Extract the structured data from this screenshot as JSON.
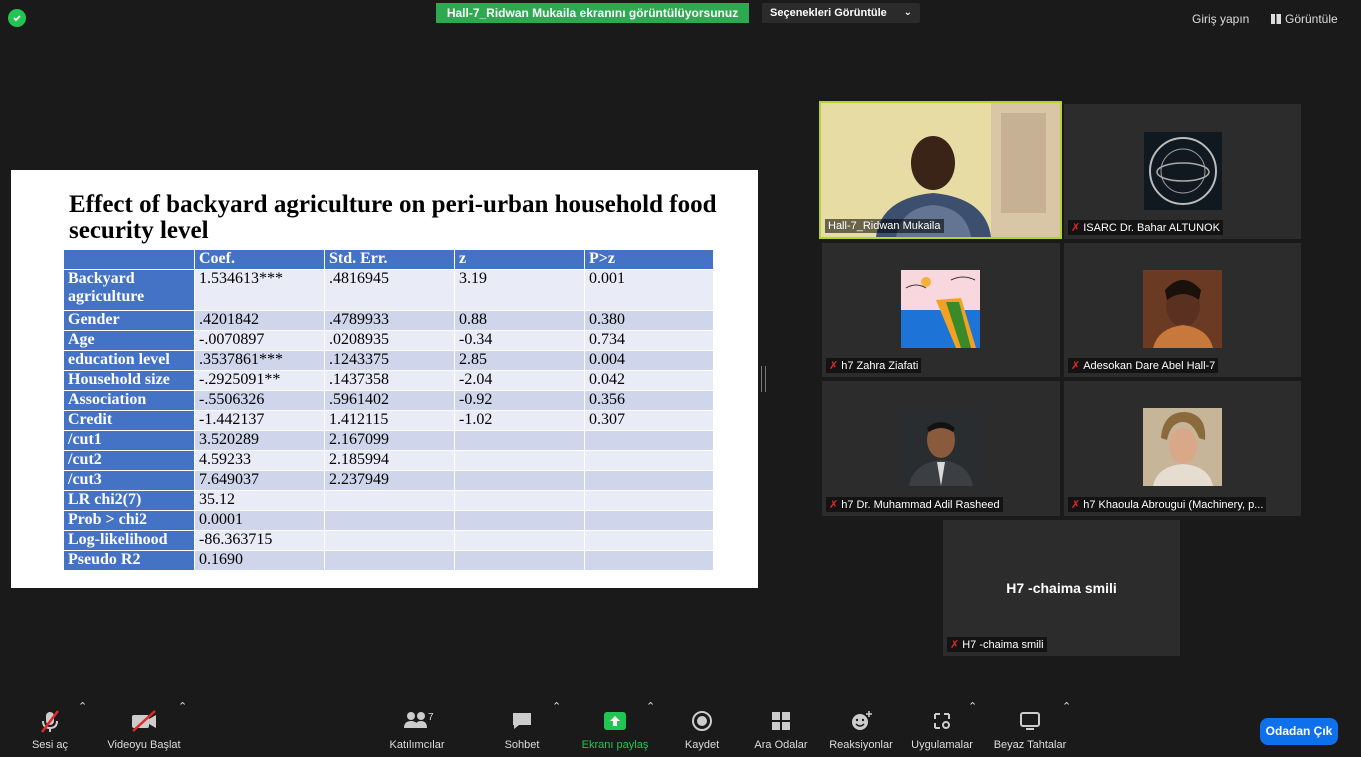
{
  "topbar": {
    "share_banner": "Hall-7_Ridwan Mukaila ekranını görüntülüyorsunuz",
    "view_options": "Seçenekleri Görüntüle",
    "sign_in": "Giriş yapın",
    "view": "Görüntüle"
  },
  "slide": {
    "title": "Effect of backyard agriculture on peri-urban household food security level",
    "headers": [
      "",
      "Coef.",
      "Std. Err.",
      "z",
      "P>z"
    ],
    "rows": [
      [
        "Backyard agriculture",
        "1.534613***",
        ".4816945",
        "3.19",
        "0.001"
      ],
      [
        "Gender",
        ".4201842",
        ".4789933",
        "0.88",
        "0.380"
      ],
      [
        "Age",
        "-.0070897",
        ".0208935",
        "-0.34",
        "0.734"
      ],
      [
        "education level",
        ".3537861***",
        ".1243375",
        "2.85",
        "0.004"
      ],
      [
        "Household size",
        "-.2925091**",
        ".1437358",
        "-2.04",
        "0.042"
      ],
      [
        "Association",
        "-.5506326",
        ".5961402",
        "-0.92",
        "0.356"
      ],
      [
        "Credit",
        "-1.442137",
        "1.412115",
        "-1.02",
        "0.307"
      ],
      [
        "/cut1",
        "3.520289",
        "2.167099",
        "",
        ""
      ],
      [
        "/cut2",
        "4.59233",
        "2.185994",
        "",
        ""
      ],
      [
        "/cut3",
        "7.649037",
        "2.237949",
        "",
        ""
      ],
      [
        "LR chi2(7)",
        "35.12",
        "",
        "",
        ""
      ],
      [
        "Prob > chi2",
        "0.0001",
        "",
        "",
        ""
      ],
      [
        "Log-likelihood",
        "-86.363715",
        "",
        "",
        ""
      ],
      [
        "Pseudo R2",
        "0.1690",
        "",
        "",
        ""
      ]
    ]
  },
  "participants": [
    {
      "name": "Hall-7_Ridwan Mukaila",
      "muted": false
    },
    {
      "name": "ISARC Dr. Bahar ALTUNOK",
      "muted": true
    },
    {
      "name": "h7 Zahra Ziafati",
      "muted": true
    },
    {
      "name": "Adesokan Dare Abel Hall-7",
      "muted": true
    },
    {
      "name": "h7 Dr. Muhammad Adil Rasheed",
      "muted": true
    },
    {
      "name": "h7 Khaoula Abrougui (Machinery, p...",
      "muted": true
    },
    {
      "name": "H7 -chaima smili",
      "muted": true,
      "display_text": "H7 -chaima smili"
    }
  ],
  "toolbar": {
    "unmute": "Sesi aç",
    "start_video": "Videoyu Başlat",
    "participants": "Katılımcılar",
    "participant_count": "7",
    "chat": "Sohbet",
    "share_screen": "Ekranı paylaş",
    "record": "Kaydet",
    "breakout_rooms": "Ara Odalar",
    "reactions": "Reaksiyonlar",
    "apps": "Uygulamalar",
    "whiteboard": "Beyaz Tahtalar",
    "leave": "Odadan Çık"
  },
  "colors": {
    "accent_green": "#2da94f",
    "leave_blue": "#0e71eb",
    "table_header": "#4472c4",
    "active_border": "#b3d236"
  }
}
